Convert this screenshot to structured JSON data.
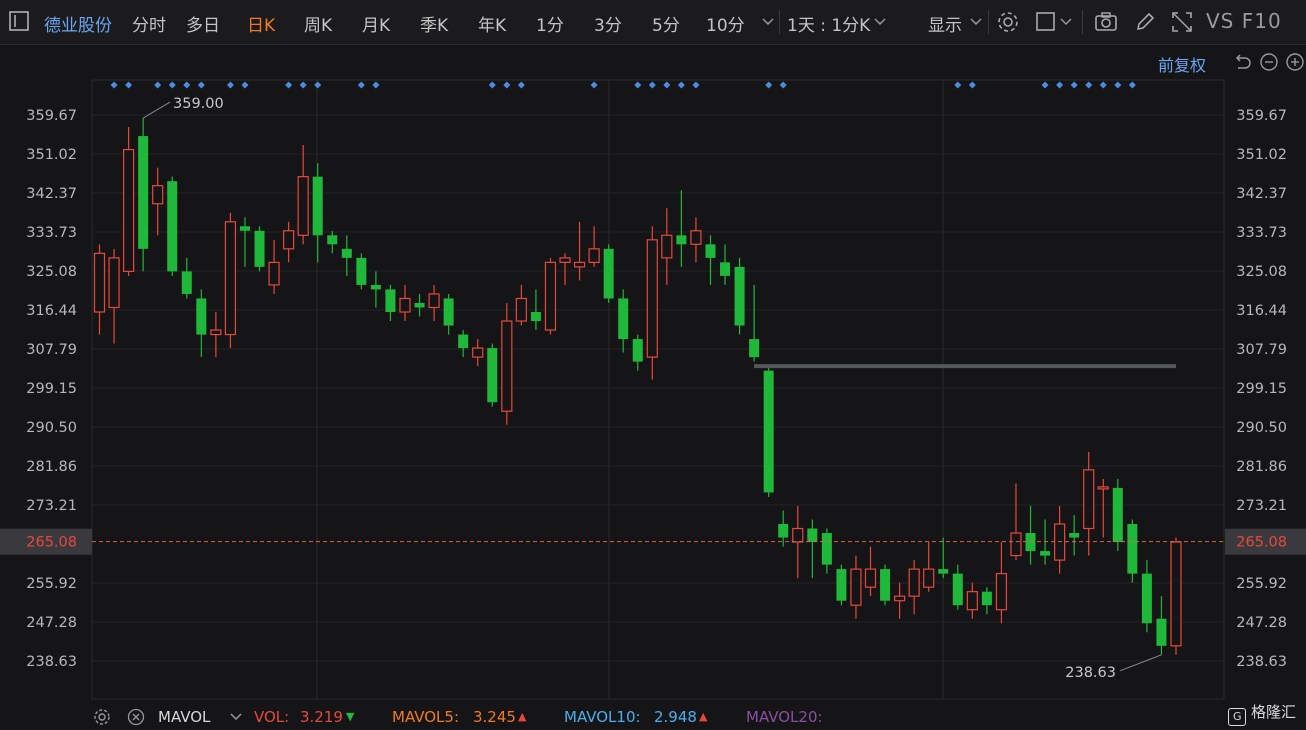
{
  "toolbar": {
    "stock_name": "德业股份",
    "tabs": [
      "分时",
      "多日",
      "日K",
      "周K",
      "月K",
      "季K",
      "年K",
      "1分",
      "3分",
      "5分",
      "10分"
    ],
    "active_tab": "日K",
    "period_select": "1天 : 1分K",
    "display_label": "显示",
    "vs_label": "VS",
    "f10_label": "F10"
  },
  "adjust_label": "前复权",
  "colors": {
    "up": "#e8483c",
    "down": "#1fb83a",
    "accent": "#f07b1e",
    "blue": "#6aa6f2",
    "current_line": "#e0663a"
  },
  "chart_data": {
    "type": "candlestick",
    "y_ticks": [
      "359.67",
      "351.02",
      "342.37",
      "333.73",
      "325.08",
      "316.44",
      "307.79",
      "299.15",
      "290.50",
      "281.86",
      "273.21",
      "265.08",
      "255.92",
      "247.28",
      "238.63"
    ],
    "ylim": [
      238.63,
      359.67
    ],
    "current_price": "265.08",
    "max_label": "359.00",
    "min_label": "238.63",
    "resistance_level": 304.0,
    "candles": [
      {
        "o": 316,
        "c": 329,
        "h": 331,
        "l": 311
      },
      {
        "o": 317,
        "c": 328,
        "h": 330,
        "l": 309
      },
      {
        "o": 325,
        "c": 352,
        "h": 357,
        "l": 324
      },
      {
        "o": 355,
        "c": 330,
        "h": 359,
        "l": 325
      },
      {
        "o": 340,
        "c": 344,
        "h": 348,
        "l": 333
      },
      {
        "o": 345,
        "c": 325,
        "h": 346,
        "l": 324
      },
      {
        "o": 325,
        "c": 320,
        "h": 328,
        "l": 319
      },
      {
        "o": 319,
        "c": 311,
        "h": 321,
        "l": 306
      },
      {
        "o": 311,
        "c": 312,
        "h": 316,
        "l": 306
      },
      {
        "o": 311,
        "c": 336,
        "h": 338,
        "l": 308
      },
      {
        "o": 335,
        "c": 334,
        "h": 337,
        "l": 326
      },
      {
        "o": 334,
        "c": 326,
        "h": 335,
        "l": 325
      },
      {
        "o": 322,
        "c": 327,
        "h": 332,
        "l": 320
      },
      {
        "o": 330,
        "c": 334,
        "h": 336,
        "l": 327
      },
      {
        "o": 333,
        "c": 346,
        "h": 353,
        "l": 331
      },
      {
        "o": 346,
        "c": 333,
        "h": 349,
        "l": 327
      },
      {
        "o": 333,
        "c": 331,
        "h": 334,
        "l": 329
      },
      {
        "o": 330,
        "c": 328,
        "h": 333,
        "l": 324
      },
      {
        "o": 328,
        "c": 322,
        "h": 329,
        "l": 321
      },
      {
        "o": 322,
        "c": 321,
        "h": 325,
        "l": 317
      },
      {
        "o": 321,
        "c": 316,
        "h": 322,
        "l": 314
      },
      {
        "o": 316,
        "c": 319,
        "h": 322,
        "l": 314
      },
      {
        "o": 318,
        "c": 317,
        "h": 320,
        "l": 315
      },
      {
        "o": 317,
        "c": 320,
        "h": 322,
        "l": 314
      },
      {
        "o": 319,
        "c": 313,
        "h": 320,
        "l": 311
      },
      {
        "o": 311,
        "c": 308,
        "h": 312,
        "l": 306
      },
      {
        "o": 306,
        "c": 308,
        "h": 310,
        "l": 304
      },
      {
        "o": 308,
        "c": 296,
        "h": 309,
        "l": 295
      },
      {
        "o": 294,
        "c": 314,
        "h": 318,
        "l": 291
      },
      {
        "o": 314,
        "c": 319,
        "h": 322,
        "l": 313
      },
      {
        "o": 316,
        "c": 314,
        "h": 321,
        "l": 312
      },
      {
        "o": 312,
        "c": 327,
        "h": 328,
        "l": 311
      },
      {
        "o": 327,
        "c": 328,
        "h": 329,
        "l": 322
      },
      {
        "o": 326,
        "c": 327,
        "h": 336,
        "l": 323
      },
      {
        "o": 327,
        "c": 330,
        "h": 335,
        "l": 326
      },
      {
        "o": 330,
        "c": 319,
        "h": 331,
        "l": 318
      },
      {
        "o": 319,
        "c": 310,
        "h": 321,
        "l": 307
      },
      {
        "o": 310,
        "c": 305,
        "h": 311,
        "l": 303
      },
      {
        "o": 306,
        "c": 332,
        "h": 335,
        "l": 301
      },
      {
        "o": 328,
        "c": 333,
        "h": 339,
        "l": 322
      },
      {
        "o": 333,
        "c": 331,
        "h": 343,
        "l": 326
      },
      {
        "o": 331,
        "c": 334,
        "h": 337,
        "l": 327
      },
      {
        "o": 331,
        "c": 328,
        "h": 333,
        "l": 322
      },
      {
        "o": 327,
        "c": 324,
        "h": 331,
        "l": 322
      },
      {
        "o": 326,
        "c": 313,
        "h": 328,
        "l": 311
      },
      {
        "o": 310,
        "c": 306,
        "h": 322,
        "l": 305
      },
      {
        "o": 303,
        "c": 276,
        "h": 304,
        "l": 275
      },
      {
        "o": 269,
        "c": 266,
        "h": 272,
        "l": 264
      },
      {
        "o": 265,
        "c": 268,
        "h": 273,
        "l": 257
      },
      {
        "o": 268,
        "c": 265,
        "h": 270,
        "l": 257
      },
      {
        "o": 267,
        "c": 260,
        "h": 268,
        "l": 258
      },
      {
        "o": 259,
        "c": 252,
        "h": 260,
        "l": 251
      },
      {
        "o": 251,
        "c": 259,
        "h": 262,
        "l": 248
      },
      {
        "o": 255,
        "c": 259,
        "h": 264,
        "l": 253
      },
      {
        "o": 259,
        "c": 252,
        "h": 260,
        "l": 251
      },
      {
        "o": 252,
        "c": 253,
        "h": 256,
        "l": 248
      },
      {
        "o": 253,
        "c": 259,
        "h": 261,
        "l": 249
      },
      {
        "o": 255,
        "c": 259,
        "h": 265,
        "l": 254
      },
      {
        "o": 259,
        "c": 258,
        "h": 266,
        "l": 257
      },
      {
        "o": 258,
        "c": 251,
        "h": 260,
        "l": 250
      },
      {
        "o": 250,
        "c": 254,
        "h": 256,
        "l": 248
      },
      {
        "o": 254,
        "c": 251,
        "h": 255,
        "l": 249
      },
      {
        "o": 250,
        "c": 258,
        "h": 265,
        "l": 247
      },
      {
        "o": 262,
        "c": 267,
        "h": 278,
        "l": 261
      },
      {
        "o": 267,
        "c": 263,
        "h": 273,
        "l": 260
      },
      {
        "o": 263,
        "c": 262,
        "h": 270,
        "l": 260
      },
      {
        "o": 261,
        "c": 269,
        "h": 273,
        "l": 258
      },
      {
        "o": 267,
        "c": 266,
        "h": 271,
        "l": 262
      },
      {
        "o": 268,
        "c": 281,
        "h": 285,
        "l": 262
      },
      {
        "o": 277,
        "c": 277,
        "h": 279,
        "l": 266
      },
      {
        "o": 277,
        "c": 265,
        "h": 279,
        "l": 263
      },
      {
        "o": 269,
        "c": 258,
        "h": 270,
        "l": 256
      },
      {
        "o": 258,
        "c": 247,
        "h": 261,
        "l": 245
      },
      {
        "o": 248,
        "c": 242,
        "h": 253,
        "l": 240
      },
      {
        "o": 242,
        "c": 265,
        "h": 266,
        "l": 240
      }
    ],
    "markers": [
      1,
      2,
      4,
      5,
      6,
      7,
      9,
      10,
      13,
      14,
      15,
      18,
      19,
      27,
      28,
      29,
      34,
      37,
      38,
      39,
      40,
      41,
      46,
      47,
      59,
      60,
      65,
      66,
      67,
      68,
      69,
      70,
      71
    ]
  },
  "bottom": {
    "ind_name": "MAVOL",
    "vol_label": "VOL:",
    "vol_value": "3.219",
    "mavol5_label": "MAVOL5:",
    "mavol5_value": "3.245",
    "mavol10_label": "MAVOL10:",
    "mavol10_value": "2.948",
    "mavol20_label": "MAVOL20:",
    "logo_text": "格隆汇"
  }
}
